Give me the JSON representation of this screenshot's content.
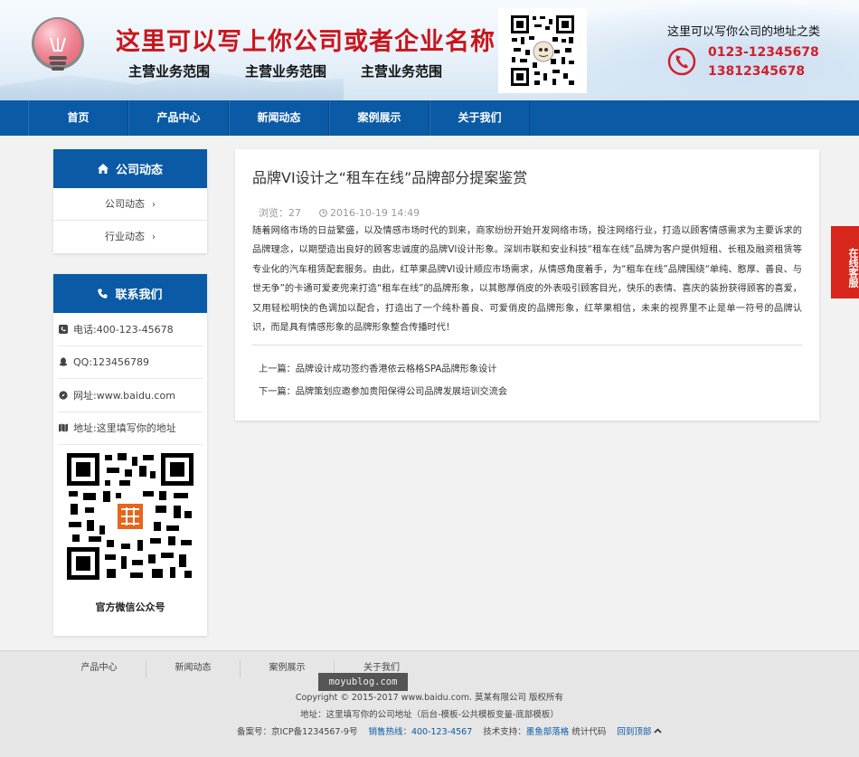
{
  "header": {
    "company_name": "这里可以写上你公司或者企业名称",
    "business": [
      "主营业务范围",
      "主营业务范围",
      "主营业务范围"
    ],
    "address": "这里可以写你公司的地址之类",
    "phones": [
      "0123-12345678",
      "13812345678"
    ]
  },
  "nav": {
    "items": [
      "首页",
      "产品中心",
      "新闻动态",
      "案例展示",
      "关于我们"
    ]
  },
  "sidebar": {
    "news": {
      "title": "公司动态",
      "items": [
        "公司动态",
        "行业动态"
      ]
    },
    "contact": {
      "title": "联系我们",
      "phone": "电话:400-123-45678",
      "qq": "QQ:123456789",
      "website": "网址:www.baidu.com",
      "address": "地址:这里填写你的地址",
      "qr_label": "官方微信公众号"
    }
  },
  "article": {
    "title": "品牌VI设计之“租车在线”品牌部分提案鉴赏",
    "views": "浏览：27",
    "time": "2016-10-19 14:49",
    "body": "随着网络市场的日益繁盛，以及情感市场时代的到来，商家纷纷开始开发网络市场，投注网络行业，打造以顾客情感需求为主要诉求的品牌理念，以期塑造出良好的顾客忠诚度的品牌VI设计形象。深圳市联和安业科技“租车在线”品牌为客户提供短租、长租及融资租赁等专业化的汽车租赁配套服务。由此，红苹果品牌VI设计顺应市场需求，从情感角度着手，为“租车在线”品牌围绕“单纯、憨厚、善良、与世无争”的卡通可爱麦兜来打造“租车在线”的品牌形象，以其憨厚俏皮的外表吸引顾客目光，快乐的表情、喜庆的装扮获得顾客的喜爱，又用轻松明快的色调加以配合，打造出了一个纯朴善良、可爱俏皮的品牌形象，红苹果相信，未来的视界里不止是单一符号的品牌认识，而是具有情感形象的品牌形象整合传播时代！",
    "prev_label": "上一篇：",
    "prev_link": "品牌设计成功签约香港依云格格SPA品牌形象设计",
    "next_label": "下一篇：",
    "next_link": "品牌策划应邀参加贵阳保得公司品牌发展培训交流会"
  },
  "float_tab": "在线客服",
  "footer": {
    "links": [
      "产品中心",
      "新闻动态",
      "案例展示",
      "关于我们"
    ],
    "watermark": "moyublog.com",
    "copyright": "Copyright © 2015-2017 www.baidu.com. 莫某有限公司 版权所有",
    "address": "地址：这里填写你的公司地址（后台-模板-公共模板变量-底部模板）",
    "icp": "备案号：京ICP备1234567-9号",
    "hotline": "销售热线：400-123-4567",
    "support_label": "技术支持：",
    "support_link": "墨鱼部落格",
    "stats": "统计代码",
    "back_top": "回到顶部"
  },
  "colors": {
    "primary": "#0b5aa6",
    "brand_red": "#c8161d",
    "float_red": "#d7261b"
  }
}
